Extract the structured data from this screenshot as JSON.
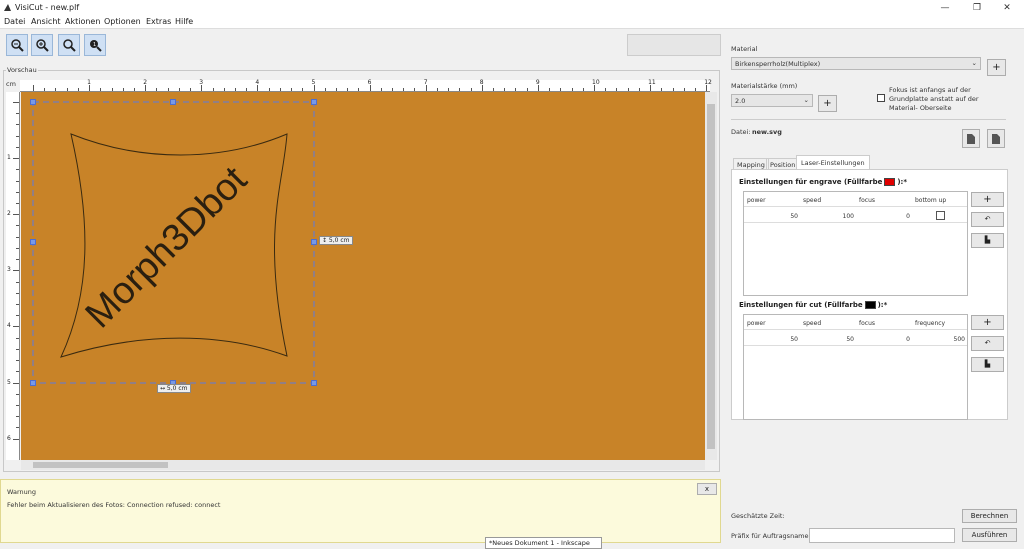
{
  "window": {
    "title": "VisiCut - new.plf",
    "controls": [
      "—",
      "❐",
      "✕"
    ]
  },
  "menu": [
    "Datei",
    "Ansicht",
    "Aktionen",
    "Optionen",
    "Extras",
    "Hilfe"
  ],
  "toolbar": {
    "icons": [
      "zoom-out-icon",
      "zoom-in-icon",
      "zoom-fit-icon",
      "zoom-info-icon"
    ]
  },
  "preview": {
    "label": "Vorschau",
    "unit": "cm",
    "ruler_x": [
      "1",
      "2",
      "3",
      "4",
      "5",
      "6",
      "7",
      "8",
      "9",
      "10",
      "11",
      "12"
    ],
    "ruler_y": [
      "1",
      "2",
      "3",
      "4",
      "5",
      "6"
    ],
    "text": "Morph3Dbot",
    "width_label": "↔ 5,0 cm",
    "height_label": "↕ 5,0 cm",
    "bg": "#c88328"
  },
  "warning": {
    "title": "Warnung",
    "message": "Fehler beim Aktualisieren des Fotos: Connection refused: connect",
    "close": "x"
  },
  "taskbar_tip": "*Neues Dokument 1 - Inkscape",
  "right": {
    "material_label": "Material",
    "material_value": "Birkensperrholz(Multiplex)",
    "add": "+",
    "thickness_label": "Materialstärke (mm)",
    "thickness_value": "2.0",
    "focus_label": "Fokus ist anfangs auf der Grundplatte anstatt auf der Material- Oberseite",
    "file_label": "Datei:",
    "file_name": "new.svg",
    "tabs": [
      "Mapping",
      "Position",
      "Laser-Einstellungen"
    ],
    "engrave": {
      "title_pre": "Einstellungen für engrave (Füllfarbe",
      "title_post": "):*",
      "color": "#e00000",
      "headers": [
        "power",
        "speed",
        "focus",
        "bottom up"
      ],
      "values": [
        "50",
        "100",
        "0",
        ""
      ]
    },
    "cut": {
      "title_pre": "Einstellungen für cut (Füllfarbe",
      "title_post": "):*",
      "color": "#000000",
      "headers": [
        "power",
        "speed",
        "focus",
        "frequency"
      ],
      "values": [
        "50",
        "50",
        "0",
        "500"
      ]
    },
    "est_label": "Geschätzte Zeit:",
    "calc_btn": "Berechnen",
    "job_label": "Präfix für Auftragsname:",
    "run_btn": "Ausführen"
  }
}
